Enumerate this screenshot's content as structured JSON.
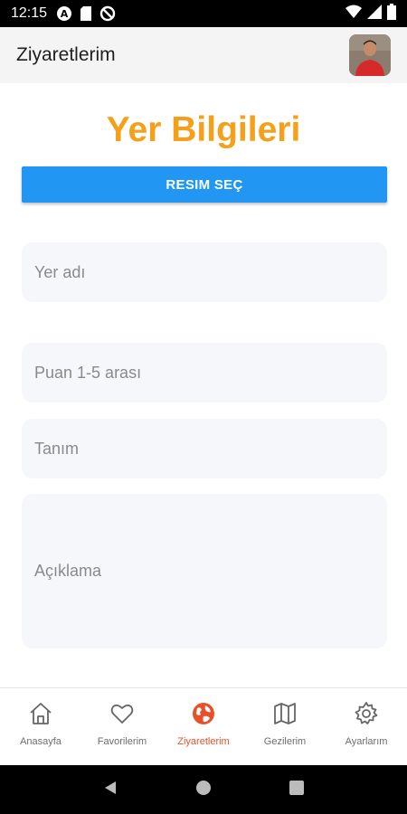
{
  "status_bar": {
    "time": "12:15"
  },
  "app_bar": {
    "title": "Ziyaretlerim"
  },
  "form": {
    "title": "Yer Bilgileri",
    "pick_image_label": "RESIM SEÇ",
    "name_placeholder": "Yer adı",
    "rating_placeholder": "Puan 1-5 arası",
    "definition_placeholder": "Tanım",
    "description_placeholder": "Açıklama"
  },
  "bottom_nav": {
    "items": [
      {
        "label": "Anasayfa",
        "icon": "home-icon"
      },
      {
        "label": "Favorilerim",
        "icon": "heart-icon"
      },
      {
        "label": "Ziyaretlerim",
        "icon": "globe-icon"
      },
      {
        "label": "Gezilerim",
        "icon": "map-icon"
      },
      {
        "label": "Ayarlarım",
        "icon": "gear-icon"
      }
    ],
    "active_index": 2
  },
  "colors": {
    "accent_orange": "#f5a01a",
    "button_blue": "#2196f3",
    "active_nav": "#e9502a"
  }
}
